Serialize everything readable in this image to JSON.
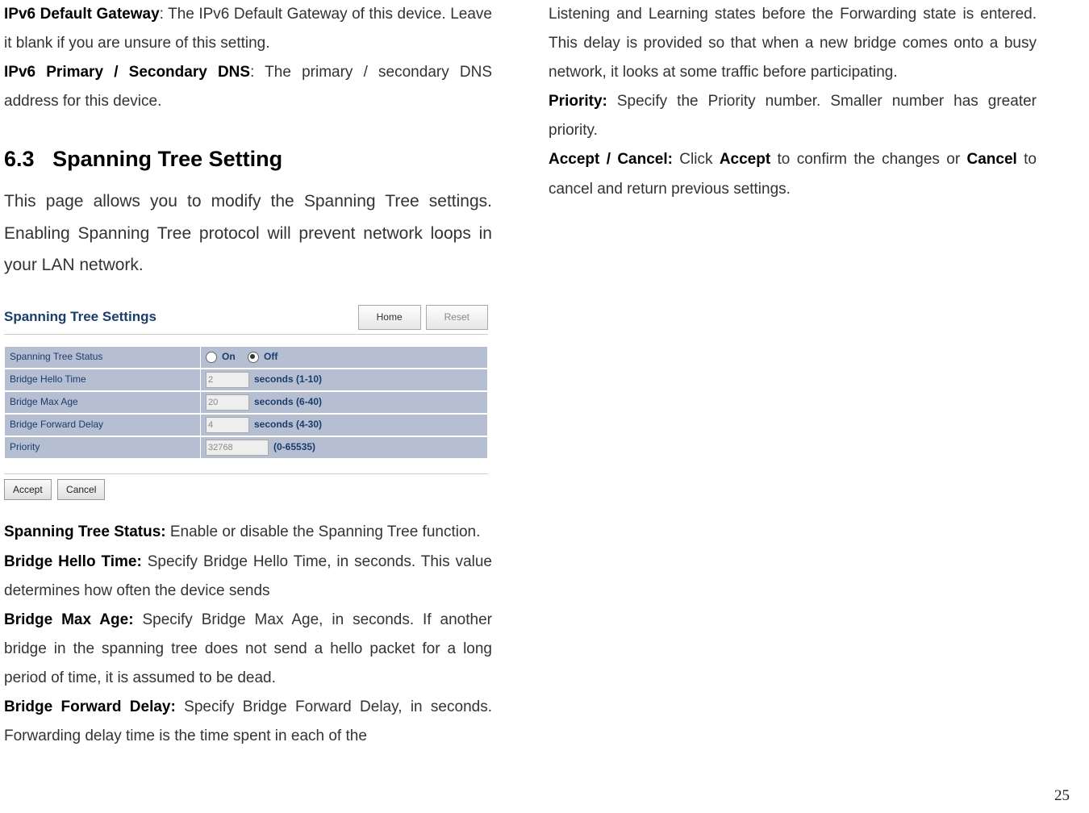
{
  "col1": {
    "p1_bold": "IPv6 Default Gateway",
    "p1_rest": ": The IPv6 Default Gateway of this device. Leave it blank if you are unsure of this setting.",
    "p2_bold": "IPv6 Primary / Secondary DNS",
    "p2_rest": ": The primary / secondary DNS address for this device.",
    "section_no": "6.3",
    "section_title": "Spanning Tree Setting",
    "intro": "This page allows you to modify the Spanning Tree settings. Enabling Spanning Tree protocol will prevent network loops in your LAN network.",
    "d1_bold": "Spanning Tree Status:",
    "d1_rest": " Enable or disable the Spanning Tree function.",
    "d2_bold": "Bridge Hello Time:",
    "d2_rest": " Specify Bridge Hello Time, in seconds. This value determines how often the device sends",
    "d3_bold": "Bridge Max Age:",
    "d3_rest": " Specify Bridge Max Age, in seconds. If another bridge in the spanning tree does not send a hello packet for a long period of time, it is assumed to be dead.",
    "d4_bold": "Bridge Forward Delay:",
    "d4_rest": " Specify Bridge Forward Delay, in seconds. Forwarding delay time is the time spent in each of the"
  },
  "col2": {
    "p1": "Listening and Learning states before the Forwarding state is entered. This delay is provided so that when a new bridge comes onto a busy network, it looks at some traffic before participating.",
    "p2_bold": "Priority:",
    "p2_rest": " Specify the Priority number. Smaller number has greater priority.",
    "p3_b1": "Accept / Cancel:",
    "p3_t1": " Click ",
    "p3_b2": "Accept",
    "p3_t2": " to confirm the changes or ",
    "p3_b3": "Cancel",
    "p3_t3": " to cancel and return previous settings."
  },
  "shot": {
    "title": "Spanning Tree Settings",
    "tab_home": "Home",
    "tab_reset": "Reset",
    "rows": {
      "r0_label": "Spanning Tree Status",
      "r0_on": "On",
      "r0_off": "Off",
      "r1_label": "Bridge Hello Time",
      "r1_val": "2",
      "r1_hint": "seconds (1-10)",
      "r2_label": "Bridge Max Age",
      "r2_val": "20",
      "r2_hint": "seconds (6-40)",
      "r3_label": "Bridge Forward Delay",
      "r3_val": "4",
      "r3_hint": "seconds (4-30)",
      "r4_label": "Priority",
      "r4_val": "32768",
      "r4_hint": "(0-65535)"
    },
    "btn_accept": "Accept",
    "btn_cancel": "Cancel"
  },
  "page_number": "25"
}
